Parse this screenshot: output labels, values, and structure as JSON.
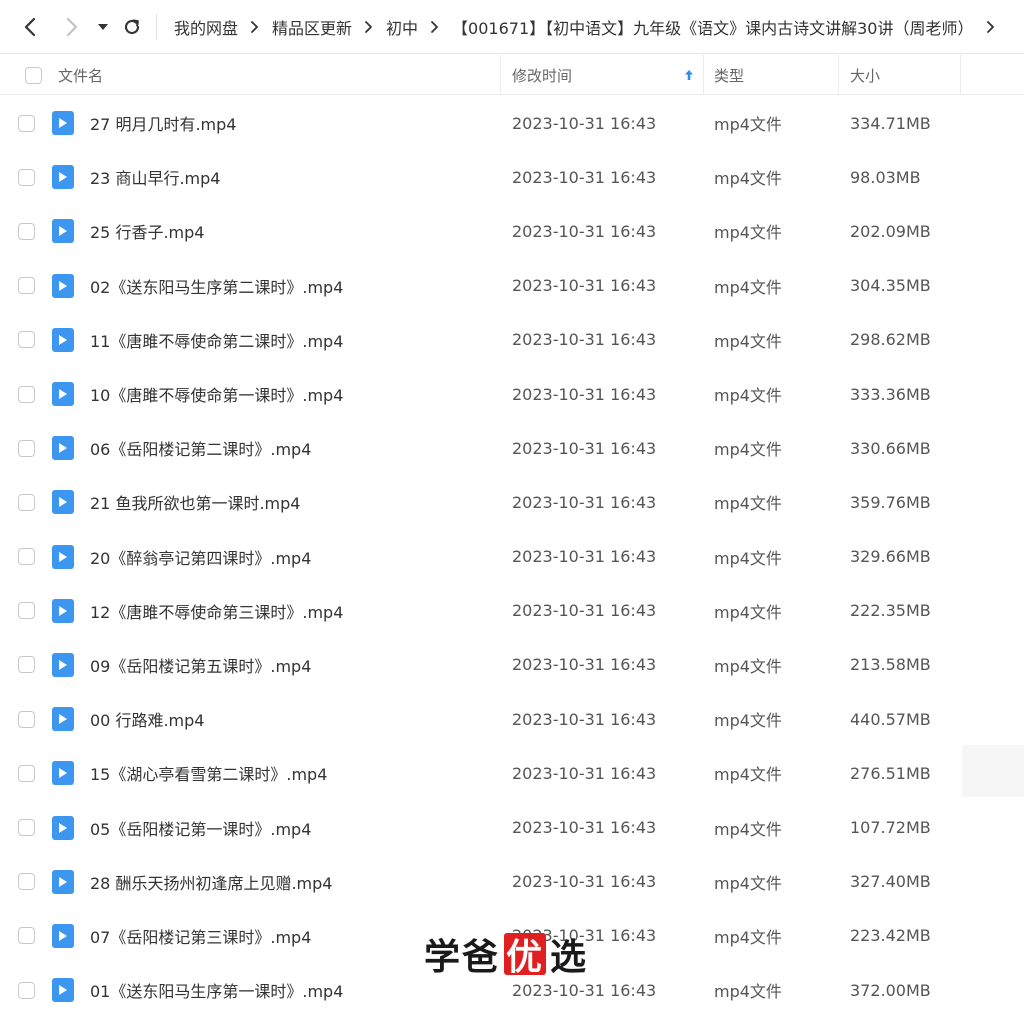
{
  "nav": {
    "back_icon": "chevron-left-icon",
    "forward_icon": "chevron-right-icon",
    "history_icon": "caret-down-icon",
    "refresh_icon": "refresh-icon"
  },
  "breadcrumb": [
    "我的网盘",
    "精品区更新",
    "初中",
    "【001671】【初中语文】九年级《语文》课内古诗文讲解30讲（周老师）"
  ],
  "columns": {
    "name": "文件名",
    "modified": "修改时间",
    "type": "类型",
    "size": "大小",
    "sort_icon": "arrow-up-icon"
  },
  "colors": {
    "file_icon": "#3d97f0",
    "sort_arrow": "#2f8ff0",
    "watermark_badge": "#e02020"
  },
  "files": [
    {
      "name": "27 明月几时有.mp4",
      "modified": "2023-10-31 16:43",
      "type": "mp4文件",
      "size": "334.71MB"
    },
    {
      "name": "23 商山早行.mp4",
      "modified": "2023-10-31 16:43",
      "type": "mp4文件",
      "size": "98.03MB"
    },
    {
      "name": "25 行香子.mp4",
      "modified": "2023-10-31 16:43",
      "type": "mp4文件",
      "size": "202.09MB"
    },
    {
      "name": "02《送东阳马生序第二课时》.mp4",
      "modified": "2023-10-31 16:43",
      "type": "mp4文件",
      "size": "304.35MB"
    },
    {
      "name": "11《唐雎不辱使命第二课时》.mp4",
      "modified": "2023-10-31 16:43",
      "type": "mp4文件",
      "size": "298.62MB"
    },
    {
      "name": "10《唐雎不辱使命第一课时》.mp4",
      "modified": "2023-10-31 16:43",
      "type": "mp4文件",
      "size": "333.36MB"
    },
    {
      "name": "06《岳阳楼记第二课时》.mp4",
      "modified": "2023-10-31 16:43",
      "type": "mp4文件",
      "size": "330.66MB"
    },
    {
      "name": "21 鱼我所欲也第一课时.mp4",
      "modified": "2023-10-31 16:43",
      "type": "mp4文件",
      "size": "359.76MB"
    },
    {
      "name": "20《醉翁亭记第四课时》.mp4",
      "modified": "2023-10-31 16:43",
      "type": "mp4文件",
      "size": "329.66MB"
    },
    {
      "name": "12《唐雎不辱使命第三课时》.mp4",
      "modified": "2023-10-31 16:43",
      "type": "mp4文件",
      "size": "222.35MB"
    },
    {
      "name": "09《岳阳楼记第五课时》.mp4",
      "modified": "2023-10-31 16:43",
      "type": "mp4文件",
      "size": "213.58MB"
    },
    {
      "name": "00 行路难.mp4",
      "modified": "2023-10-31 16:43",
      "type": "mp4文件",
      "size": "440.57MB"
    },
    {
      "name": "15《湖心亭看雪第二课时》.mp4",
      "modified": "2023-10-31 16:43",
      "type": "mp4文件",
      "size": "276.51MB"
    },
    {
      "name": "05《岳阳楼记第一课时》.mp4",
      "modified": "2023-10-31 16:43",
      "type": "mp4文件",
      "size": "107.72MB"
    },
    {
      "name": "28 酬乐天扬州初逢席上见赠.mp4",
      "modified": "2023-10-31 16:43",
      "type": "mp4文件",
      "size": "327.40MB"
    },
    {
      "name": "07《岳阳楼记第三课时》.mp4",
      "modified": "2023-10-31 16:43",
      "type": "mp4文件",
      "size": "223.42MB"
    },
    {
      "name": "01《送东阳马生序第一课时》.mp4",
      "modified": "2023-10-31 16:43",
      "type": "mp4文件",
      "size": "372.00MB"
    }
  ],
  "watermark": {
    "part1": "学爸",
    "badge": "优",
    "part2": "选"
  }
}
